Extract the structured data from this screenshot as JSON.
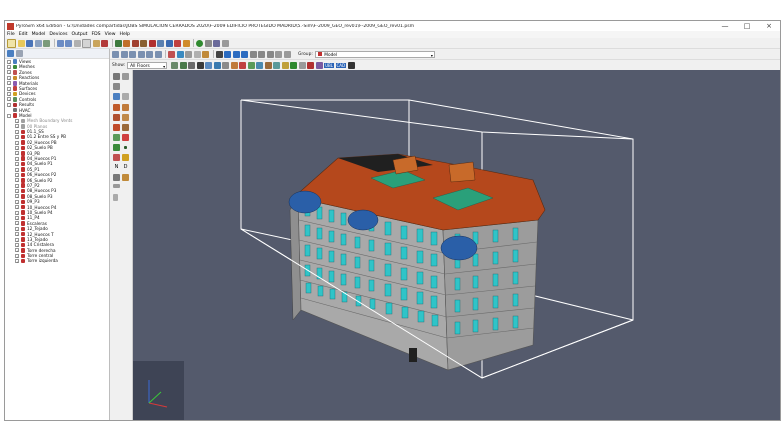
{
  "window": {
    "title": "PyroSim x64 Edition - G:\\Unidades compartidas\\JOBS SIMULACIÓN CERRADOS 2020\\F-2009 EDIFICIO PROTEGIDO MADRID\\5.-Sim\\F-2009_GEO_rev01\\F-2009_GEO_rev01.psm",
    "controls": [
      "—",
      "□",
      "×"
    ]
  },
  "menu": [
    "File",
    "Edit",
    "Model",
    "Devices",
    "Output",
    "FDS",
    "View",
    "Help"
  ],
  "toolbar_right": {
    "show_label": "Show:",
    "show_value": "All Floors",
    "group_label": "Group:",
    "group_value": "Model",
    "chips": [
      "UBL",
      "CAD"
    ]
  },
  "tree": [
    {
      "label": "Views",
      "color": "#4a7fc1",
      "exp": "+"
    },
    {
      "label": "Meshes",
      "color": "#3b8a3b",
      "exp": "+"
    },
    {
      "label": "Zones",
      "color": "#c05050",
      "exp": "+"
    },
    {
      "label": "Reactions",
      "color": "#c78a2a",
      "exp": "+"
    },
    {
      "label": "Materials",
      "color": "#8a5ab0",
      "exp": "+"
    },
    {
      "label": "Surfaces",
      "color": "#c04040",
      "exp": "+"
    },
    {
      "label": "Devices",
      "color": "#d0a020",
      "exp": "+"
    },
    {
      "label": "Controls",
      "color": "#5a8f5a",
      "exp": "+"
    },
    {
      "label": "Results",
      "color": "#b03030",
      "exp": "+"
    },
    {
      "label": "HVAC",
      "color": "#707070",
      "exp": ""
    },
    {
      "label": "Model",
      "color": "#c03030",
      "exp": "-"
    },
    {
      "label": "Mesh Boundary Vents",
      "color": "#a0a0a0",
      "exp": "+",
      "indent": 1,
      "muted": true
    },
    {
      "label": "00 Planos",
      "color": "#a0a0a0",
      "exp": "+",
      "indent": 1,
      "muted": true
    },
    {
      "label": "01.1_SS",
      "color": "#c03030",
      "exp": "+",
      "indent": 1
    },
    {
      "label": "01.2 Entre SS y PB",
      "color": "#c03030",
      "exp": "+",
      "indent": 1
    },
    {
      "label": "02_Huecos PB",
      "color": "#c03030",
      "exp": "+",
      "indent": 1
    },
    {
      "label": "02_Suelo PB",
      "color": "#c03030",
      "exp": "+",
      "indent": 1
    },
    {
      "label": "03_PB",
      "color": "#c03030",
      "exp": "+",
      "indent": 1
    },
    {
      "label": "04_Huecos P1",
      "color": "#c03030",
      "exp": "+",
      "indent": 1
    },
    {
      "label": "04_Suelo P1",
      "color": "#c03030",
      "exp": "+",
      "indent": 1
    },
    {
      "label": "05_P1",
      "color": "#c03030",
      "exp": "+",
      "indent": 1
    },
    {
      "label": "06_Huecos P2",
      "color": "#c03030",
      "exp": "+",
      "indent": 1
    },
    {
      "label": "06_Suelo P2",
      "color": "#c03030",
      "exp": "+",
      "indent": 1
    },
    {
      "label": "07_P2",
      "color": "#c03030",
      "exp": "+",
      "indent": 1
    },
    {
      "label": "08_Huecos P3",
      "color": "#c03030",
      "exp": "+",
      "indent": 1
    },
    {
      "label": "08_Suelo P3",
      "color": "#c03030",
      "exp": "+",
      "indent": 1
    },
    {
      "label": "09_P3",
      "color": "#c03030",
      "exp": "+",
      "indent": 1
    },
    {
      "label": "10_Huecos P4",
      "color": "#c03030",
      "exp": "+",
      "indent": 1
    },
    {
      "label": "10_Suelo P4",
      "color": "#c03030",
      "exp": "+",
      "indent": 1
    },
    {
      "label": "11_P4",
      "color": "#c03030",
      "exp": "+",
      "indent": 1
    },
    {
      "label": "Escaleras",
      "color": "#c03030",
      "exp": "+",
      "indent": 1
    },
    {
      "label": "12_Tejado",
      "color": "#c03030",
      "exp": "+",
      "indent": 1
    },
    {
      "label": "12_Huecos T",
      "color": "#c03030",
      "exp": "+",
      "indent": 1
    },
    {
      "label": "13_Tejado",
      "color": "#c03030",
      "exp": "+",
      "indent": 1
    },
    {
      "label": "14 Cristalera",
      "color": "#c03030",
      "exp": "+",
      "indent": 1
    },
    {
      "label": "Torre derecha",
      "color": "#c03030",
      "exp": "+",
      "indent": 1
    },
    {
      "label": "Torre central",
      "color": "#c03030",
      "exp": "+",
      "indent": 1
    },
    {
      "label": "Torre izquierda",
      "color": "#c03030",
      "exp": "+",
      "indent": 1
    }
  ],
  "vtool_labels": [
    "N",
    "D"
  ],
  "viewport_colors": {
    "background": "#545a6c",
    "wall": "#a9a9a9",
    "roof": "#b5481c",
    "window": "#2fc4c8",
    "dome": "#2a5fa8"
  }
}
